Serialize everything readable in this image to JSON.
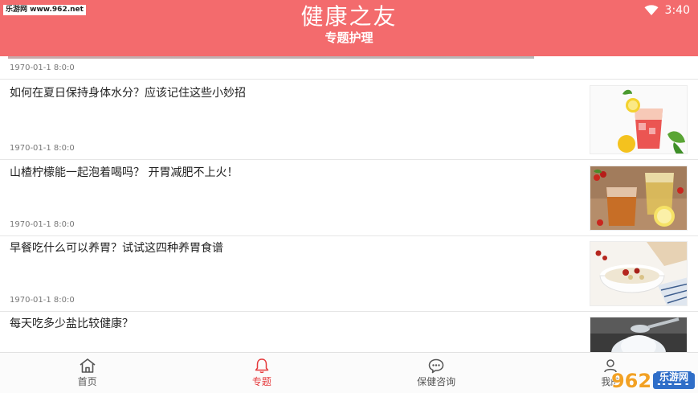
{
  "watermark_top": "乐游网 www.962.net",
  "status_bar": {
    "time": "3:40"
  },
  "header": {
    "app_title": "健康之友",
    "subtitle": "专题护理"
  },
  "list": {
    "top_date": "1970-01-1 8:0:0",
    "items": [
      {
        "title": "如何在夏日保持身体水分？应该记住这些小妙招",
        "date": "1970-01-1 8:0:0",
        "image": "iced-tea-with-lemon"
      },
      {
        "title": "山楂柠檬能一起泡着喝吗？ 开胃减肥不上火！",
        "date": "1970-01-1 8:0:0",
        "image": "tea-cups-with-lemon"
      },
      {
        "title": "早餐吃什么可以养胃？试试这四种养胃食谱",
        "date": "1970-01-1 8:0:0",
        "image": "congee-bowl"
      },
      {
        "title": "每天吃多少盐比较健康？",
        "date": "",
        "image": "salt-spoon"
      }
    ]
  },
  "nav": {
    "items": [
      {
        "label": "首页",
        "icon": "home-icon",
        "active": false
      },
      {
        "label": "专题",
        "icon": "bell-icon",
        "active": true
      },
      {
        "label": "保健咨询",
        "icon": "chat-icon",
        "active": false
      },
      {
        "label": "我的",
        "icon": "user-icon",
        "active": false
      }
    ]
  },
  "watermark_bottom": {
    "number": "962",
    "suffix": ".NET",
    "sub": "乐游网"
  },
  "colors": {
    "header": "#f36b6d",
    "accent": "#e53a3c"
  }
}
